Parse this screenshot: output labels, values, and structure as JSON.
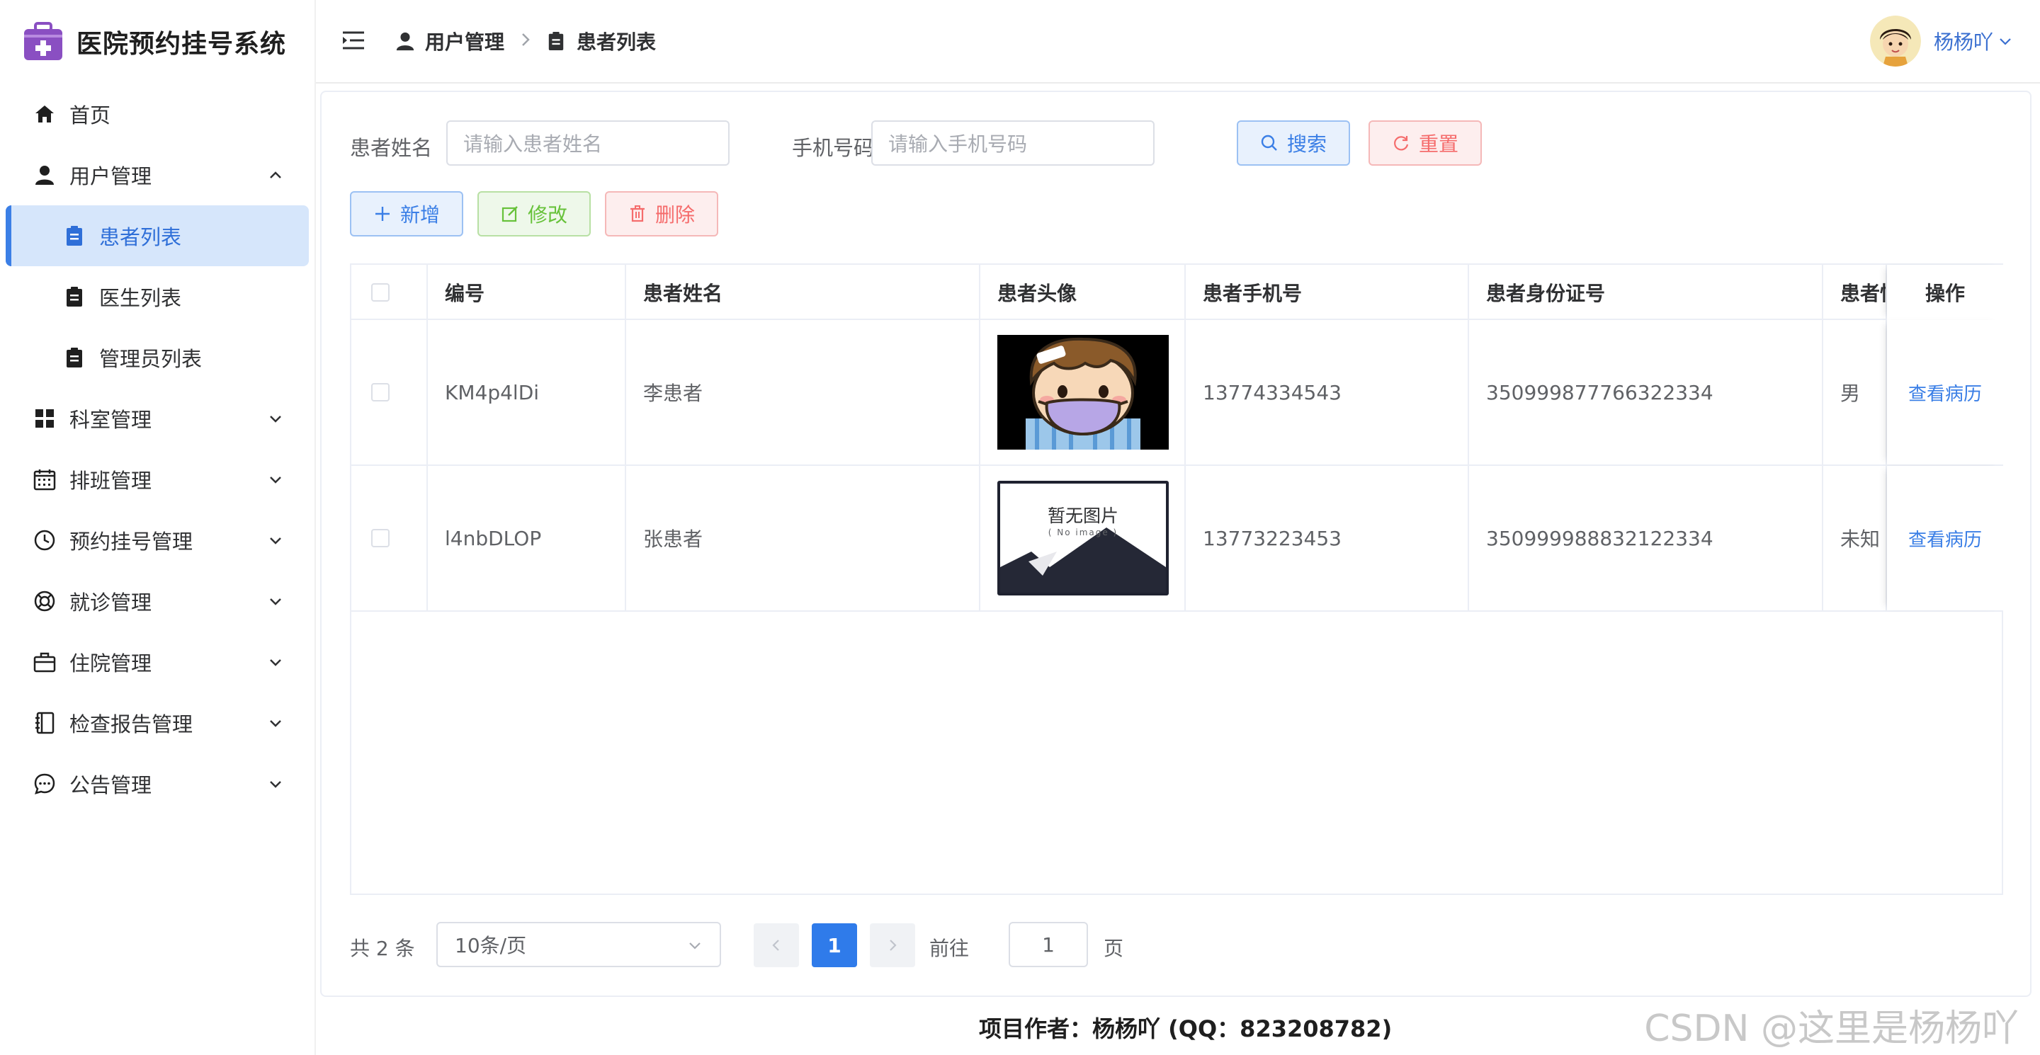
{
  "app": {
    "title": "医院预约挂号系统"
  },
  "sidebar": {
    "items": [
      {
        "label": "首页"
      },
      {
        "label": "用户管理"
      },
      {
        "label": "患者列表"
      },
      {
        "label": "医生列表"
      },
      {
        "label": "管理员列表"
      },
      {
        "label": "科室管理"
      },
      {
        "label": "排班管理"
      },
      {
        "label": "预约挂号管理"
      },
      {
        "label": "就诊管理"
      },
      {
        "label": "住院管理"
      },
      {
        "label": "检查报告管理"
      },
      {
        "label": "公告管理"
      }
    ]
  },
  "header": {
    "breadcrumb": [
      "用户管理",
      "患者列表"
    ],
    "user_name": "杨杨吖"
  },
  "search": {
    "name_label": "患者姓名",
    "name_placeholder": "请输入患者姓名",
    "phone_label": "手机号码",
    "phone_placeholder": "请输入手机号码",
    "search_button": "搜索",
    "reset_button": "重置"
  },
  "toolbar": {
    "add": "新增",
    "edit": "修改",
    "delete": "删除"
  },
  "table": {
    "headers": [
      "编号",
      "患者姓名",
      "患者头像",
      "患者手机号",
      "患者身份证号",
      "患者性",
      "操作"
    ],
    "rows": [
      {
        "id": "KM4p4lDi",
        "name": "李患者",
        "phone": "13774334543",
        "idcard": "350999877766322334",
        "gender": "男",
        "action": "查看病历"
      },
      {
        "id": "l4nbDLOP",
        "name": "张患者",
        "phone": "13773223453",
        "idcard": "350999988832122334",
        "gender": "未知",
        "action": "查看病历"
      }
    ],
    "no_image_text": "暂无图片",
    "no_image_sub": "( No image )"
  },
  "pagination": {
    "total": "共 2 条",
    "page_size": "10条/页",
    "current": "1",
    "goto_label": "前往",
    "goto_value": "1",
    "goto_unit": "页"
  },
  "footer": {
    "text": "项目作者：杨杨吖 (QQ：823208782)"
  },
  "watermark": "CSDN @这里是杨杨吖",
  "colors": {
    "primary": "#3b7fe6",
    "success": "#67c23a",
    "danger": "#f56c6c",
    "active_bg": "#d6e6fb",
    "brand": "#8a4fc2"
  }
}
